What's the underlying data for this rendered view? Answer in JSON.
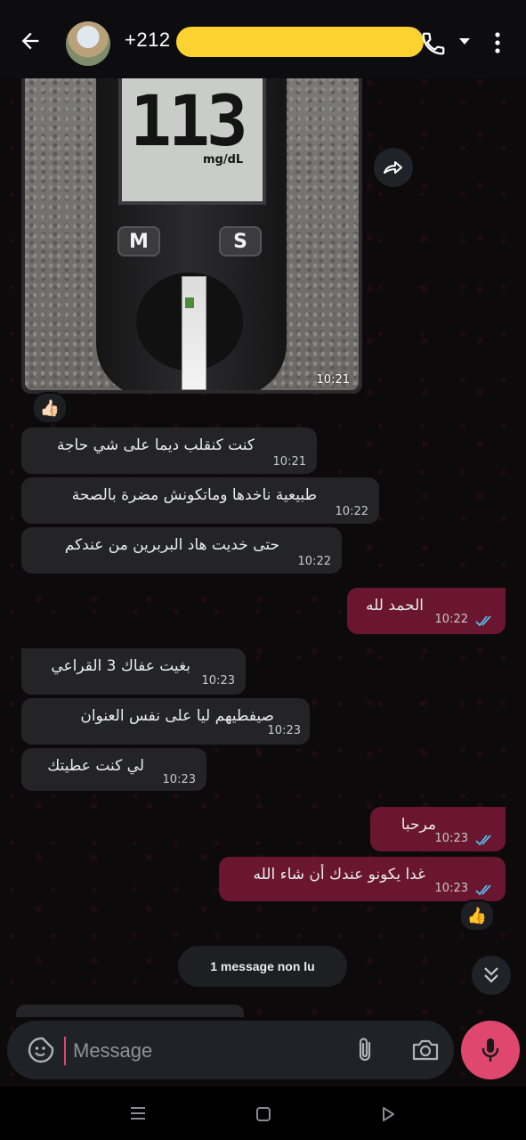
{
  "header": {
    "contact_name": "+212 6",
    "back_icon": "arrow-back-icon",
    "call_icon": "phone-icon",
    "menu_icon": "more-vert-icon"
  },
  "image_message": {
    "meter_reading": "113",
    "meter_unit": "mg/dL",
    "button_m": "M",
    "button_s": "S",
    "time": "10:21",
    "reaction": "👍🏻"
  },
  "messages": [
    {
      "direction": "in",
      "text": "كنت كنقلب ديما على شي حاجة",
      "time": "10:21"
    },
    {
      "direction": "in",
      "text": "طبيعية ناخدها وماتكونش مضرة بالصحة",
      "time": "10:22"
    },
    {
      "direction": "in",
      "text": "حتى خديت هاد البربرين من عندكم",
      "time": "10:22"
    },
    {
      "direction": "out",
      "text": "الحمد لله",
      "time": "10:22",
      "status": "read"
    },
    {
      "direction": "in",
      "text": "بغيت عفاك 3 القراعي",
      "time": "10:23"
    },
    {
      "direction": "in",
      "text": "صيفطيهم ليا على نفس العنوان",
      "time": "10:23"
    },
    {
      "direction": "in",
      "text": "لي كنت عطيتك",
      "time": "10:23"
    },
    {
      "direction": "out",
      "text": "مرحبا",
      "time": "10:23",
      "status": "read"
    },
    {
      "direction": "out",
      "text": "غدا يكونو عندك أن شاء الله",
      "time": "10:23",
      "status": "read"
    }
  ],
  "last_reaction": "👍",
  "unread_notice": "1 message non lu",
  "composer": {
    "placeholder": "Message"
  },
  "colors": {
    "incoming_bubble": "#242427",
    "outgoing_bubble": "#6b1630",
    "accent": "#e0476e",
    "read_ticks": "#53bdeb"
  }
}
